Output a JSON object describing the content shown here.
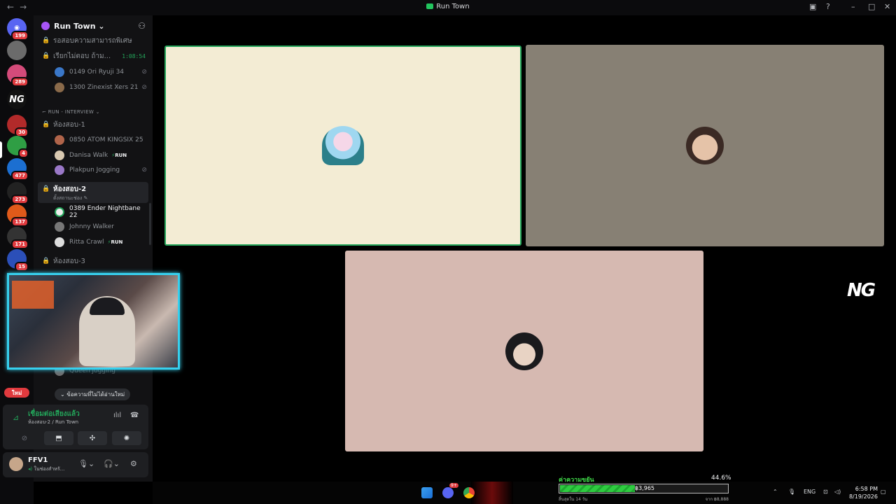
{
  "window": {
    "title": "Run Town",
    "nav_back": "←",
    "nav_fwd": "→",
    "inbox_icon": "inbox-icon",
    "help_icon": "help-icon",
    "minimize": "–",
    "maximize": "□",
    "close": "✕"
  },
  "servers": [
    {
      "label": "",
      "badge": "199",
      "color": "#5865f2"
    },
    {
      "label": "",
      "badge": "",
      "color": "#6b6b6b"
    },
    {
      "label": "",
      "badge": "289",
      "color": "#d44b7a"
    },
    {
      "label": "NG",
      "badge": "",
      "color": "#111"
    },
    {
      "label": "",
      "badge": "30",
      "color": "#b22a2a"
    },
    {
      "label": "",
      "badge": "4",
      "color": "#2f9e44"
    },
    {
      "label": "",
      "badge": "477",
      "color": "#1c6fd1"
    },
    {
      "label": "",
      "badge": "273",
      "color": "#222"
    },
    {
      "label": "",
      "badge": "137",
      "color": "#e05a1a"
    },
    {
      "label": "",
      "badge": "171",
      "color": "#333"
    },
    {
      "label": "",
      "badge": "15",
      "color": "#2b4fb8"
    },
    {
      "label": "ใหม่",
      "badge": "",
      "color": "#e03a3e"
    }
  ],
  "server_name": "Run Town",
  "channels": {
    "top_partial": "รอสอบความสามารถพิเศษ",
    "waiting": "เรียกไม่ตอบ ถ้าม...",
    "waiting_timer": "1:08:54",
    "waiting_users": [
      "0149 Ori Ryuji 34",
      "1300 Zinexist Xers 21"
    ],
    "category": "RUN - INTERVIEW",
    "room1": "ห้องสอบ-1",
    "room1_users": [
      "0850 ATOM KINGSIX 25",
      "Danisa Walk",
      "Plakpun Jogging"
    ],
    "room2": "ห้องสอบ-2",
    "room2_status": "ตั้งสถานะช่อง",
    "room2_users": [
      "0389 Ender Nightbane 22",
      "Johnny Walker",
      "Ritta Crawl"
    ],
    "room3": "ห้องสอบ-3",
    "hidden_user": "Queen Jogging",
    "run_tag": "RUN"
  },
  "new_messages": "ข้อความที่ไม่ได้อ่านใหม่",
  "voice": {
    "status": "เชื่อมต่อเสียงแล้ว",
    "location": "ห้องสอบ-2 / Run Town"
  },
  "user": {
    "name": "FFV1",
    "status": "ในช่องสำหรั..."
  },
  "overlay": {
    "logo": "NG",
    "progress_label": "ค่าความขยัน",
    "progress_pct": "44.6%",
    "progress_fraction": 0.446,
    "progress_value": "฿3,965",
    "progress_left": "สิ้นสุดใน 14 วัน",
    "progress_right": "จาก ฿8,888"
  },
  "taskbar": {
    "discord_badge": "9+",
    "lang": "ENG",
    "time": "6:58 PM",
    "date": "8/19/2026"
  },
  "colors": {
    "tile1": "#f3ecd4",
    "tile2": "#878074",
    "tile3": "#d6b9b1",
    "speaking": "#23a55a"
  }
}
